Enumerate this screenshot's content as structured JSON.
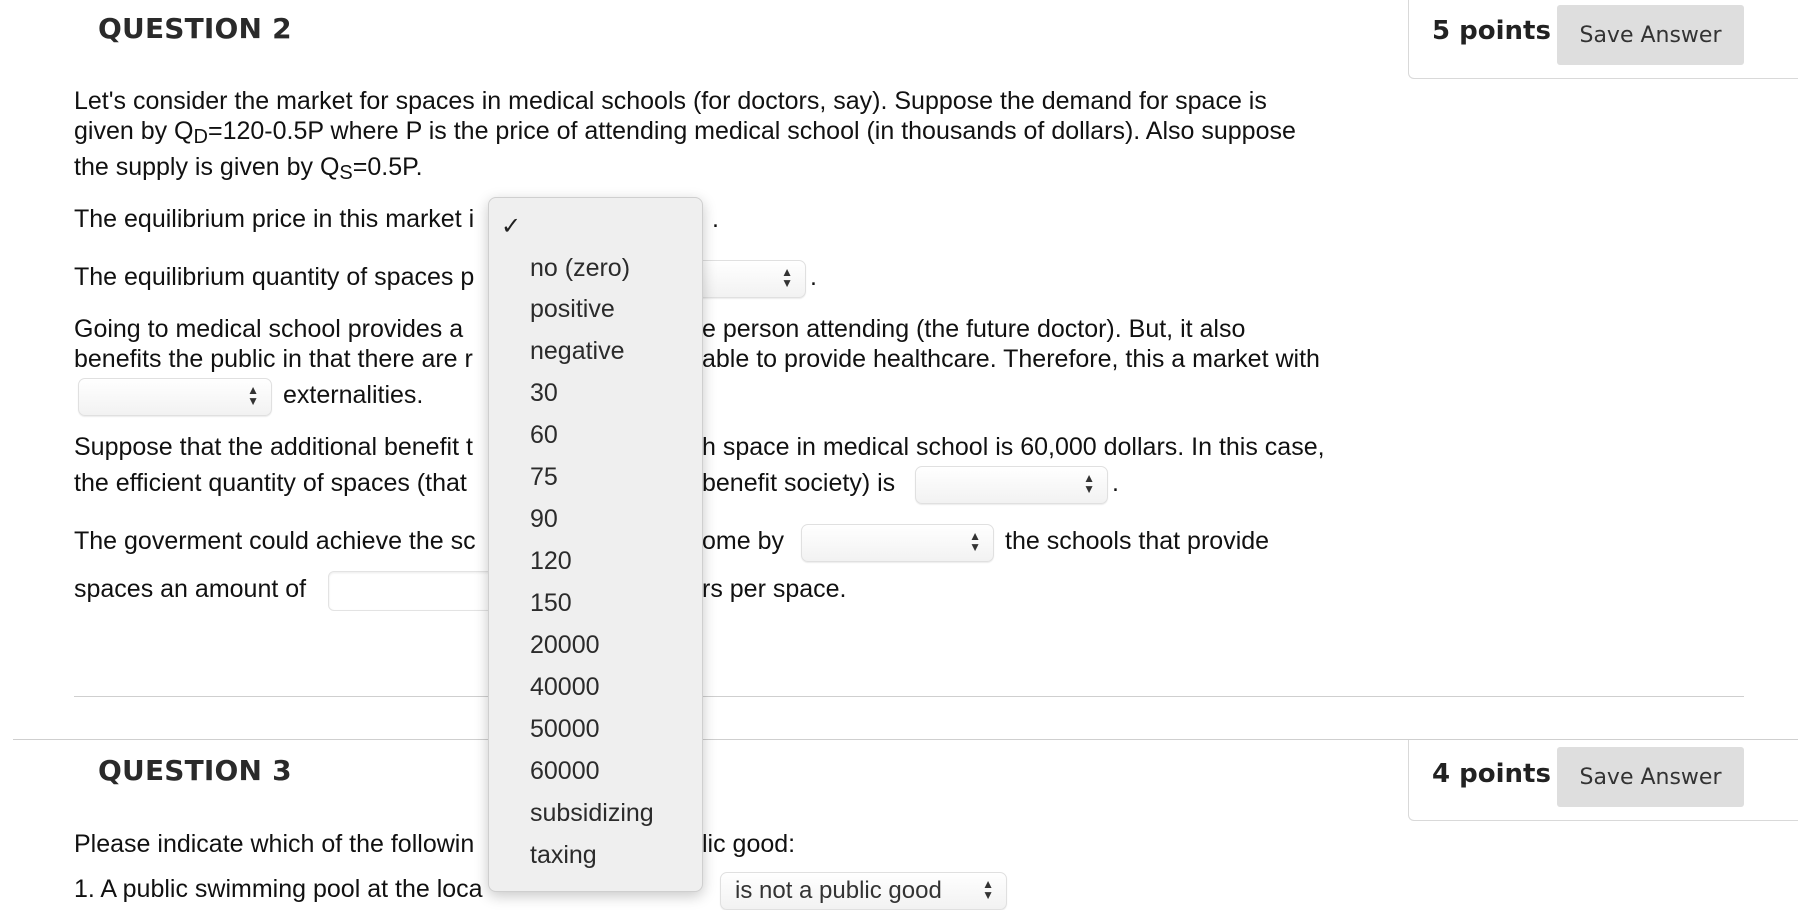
{
  "q2": {
    "title": "QUESTION 2",
    "points": "5 points",
    "save_label": "Save Answer",
    "p1_a": "Let's consider the market for spaces in medical schools (for doctors, say). Suppose the demand for space is",
    "p1_b1": "given by Q",
    "p1_b_sub": "D",
    "p1_b2": "=120-0.5P where P is the price of attending medical school (in thousands of dollars). Also suppose",
    "p1_c1": "the supply is given by Q",
    "p1_c_sub": "S",
    "p1_c2": "=0.5P.",
    "eq_price": "The equilibrium price in this market i",
    "eq_price_end": ".",
    "eq_qty": "The equilibrium quantity of spaces p",
    "eq_qty_end": ".",
    "p3_a1": "Going to medical school provides a",
    "p3_a2": "e person attending (the future doctor). But, it also",
    "p3_b1": "benefits the public in that there are r",
    "p3_b2": "able to provide healthcare. Therefore, this a market with",
    "p3_c": "externalities.",
    "p4_a1": "Suppose that the additional benefit t",
    "p4_a2": "h space in medical school is 60,000 dollars. In this case,",
    "p4_b1": "the efficient quantity of spaces (that",
    "p4_b2": "benefit society) is",
    "p4_b_end": ".",
    "p5_a1": "The goverment could achieve the sc",
    "p5_a2": "ome by",
    "p5_a3": "the schools that provide",
    "p5_b1": "spaces an amount of",
    "p5_b2": "rs per space."
  },
  "q3": {
    "title": "QUESTION 3",
    "points": "4 points",
    "save_label": "Save Answer",
    "prompt_a": "Please indicate which of the followin",
    "prompt_b": "lic good:",
    "item1_a": "1. A public swimming pool at the loca",
    "item1_b": "is not a public good"
  },
  "dropdown": {
    "selected_mark": "✓",
    "options": [
      "no (zero)",
      "positive",
      "negative",
      "30",
      "60",
      "75",
      "90",
      "120",
      "150",
      "20000",
      "40000",
      "50000",
      "60000",
      "subsidizing",
      "taxing"
    ]
  }
}
